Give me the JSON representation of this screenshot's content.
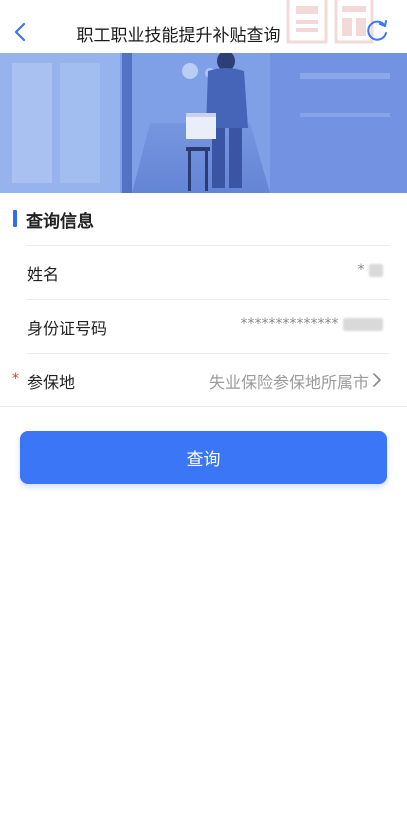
{
  "header": {
    "title": "职工职业技能提升补贴查询"
  },
  "section": {
    "title": "查询信息"
  },
  "form": {
    "name_label": "姓名",
    "name_value": "*",
    "id_label": "身份证号码",
    "id_value": "**************",
    "region_label": "参保地",
    "region_required_mark": "*",
    "region_placeholder": "失业保险参保地所属市"
  },
  "actions": {
    "query_label": "查询"
  },
  "colors": {
    "accent": "#3a76f6",
    "required": "#e53935"
  },
  "icons": [
    "back-arrow-icon",
    "seal-watermark-icon",
    "refresh-icon",
    "chevron-right-icon"
  ]
}
